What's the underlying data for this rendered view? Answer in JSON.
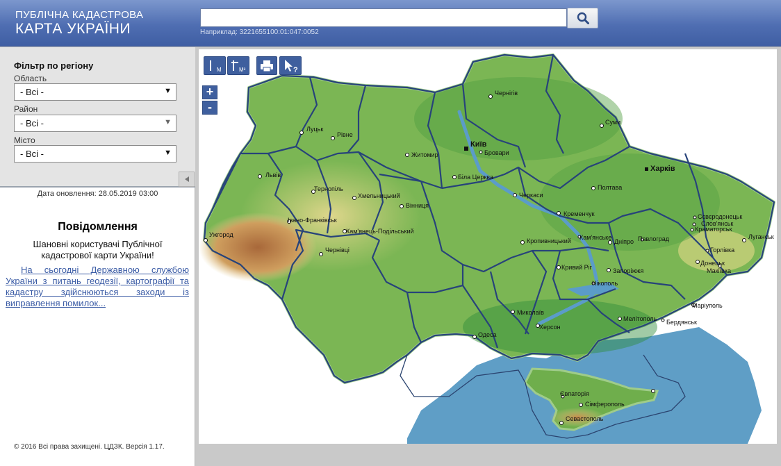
{
  "header": {
    "logo_line1": "ПУБЛІЧНА КАДАСТРОВА",
    "logo_line2": "КАРТА УКРАЇНИ",
    "search_value": "",
    "search_hint": "Наприклад: 3221655100:01:047:0052"
  },
  "filter": {
    "title": "Фільтр по регіону",
    "oblast_label": "Область",
    "oblast_value": "- Всі -",
    "rayon_label": "Район",
    "rayon_value": "- Всі -",
    "misto_label": "Місто",
    "misto_value": "- Всі -"
  },
  "sidebar": {
    "update_date": "Дата оновлення: 28.05.2019 03:00",
    "notice_title": "Повідомлення",
    "notice_subtitle": "Шановні користувачі Публічної кадастрової карти України!",
    "notice_link": "На сьогодні Державною службою України з питань геодезії, картографії та кадастру здійснюються заходи із виправлення помилок...",
    "copyright": "© 2016 Всі права захищені. ЦДЗК. Версія 1.17."
  },
  "toolbar": {
    "measure_length": "M",
    "measure_area": "M²",
    "print_icon": "printer-icon",
    "identify_icon": "cursor-question-icon",
    "identify_label": "?",
    "zoom_in": "+",
    "zoom_out": "-"
  },
  "map": {
    "cities": [
      {
        "name": "Чернігів"
      },
      {
        "name": "Суми"
      },
      {
        "name": "Луцьк"
      },
      {
        "name": "Рівне"
      },
      {
        "name": "Київ"
      },
      {
        "name": "Бровари"
      },
      {
        "name": "Житомир"
      },
      {
        "name": "Харків"
      },
      {
        "name": "Львів"
      },
      {
        "name": "Тернопіль"
      },
      {
        "name": "Хмельницький"
      },
      {
        "name": "Вінниця"
      },
      {
        "name": "Біла Церква"
      },
      {
        "name": "Черкаси"
      },
      {
        "name": "Полтава"
      },
      {
        "name": "Кременчук"
      },
      {
        "name": "Луганськ"
      },
      {
        "name": "Сєвєродонецьк"
      },
      {
        "name": "Слов'янськ"
      },
      {
        "name": "Краматорськ"
      },
      {
        "name": "Горлівка"
      },
      {
        "name": "Донецьк"
      },
      {
        "name": "Макіївка"
      },
      {
        "name": "Ужгород"
      },
      {
        "name": "Івано-Франківськ"
      },
      {
        "name": "Кам'янець-Подільський"
      },
      {
        "name": "Чернівці"
      },
      {
        "name": "Кропивницький"
      },
      {
        "name": "Кам'янське"
      },
      {
        "name": "Дніпро"
      },
      {
        "name": "Павлоград"
      },
      {
        "name": "Кривий Ріг"
      },
      {
        "name": "Запоріжжя"
      },
      {
        "name": "Нікополь"
      },
      {
        "name": "Маріуполь"
      },
      {
        "name": "Миколаїв"
      },
      {
        "name": "Херсон"
      },
      {
        "name": "Мелітополь"
      },
      {
        "name": "Бердянськ"
      },
      {
        "name": "Одеса"
      },
      {
        "name": "Євпаторія"
      },
      {
        "name": "Сімферополь"
      },
      {
        "name": "Севастополь"
      }
    ]
  },
  "colors": {
    "header_blue": "#4f6eb2",
    "button_blue": "#3f5f9e",
    "sea": "#5f9ec6",
    "lowland": "#6fb04a",
    "upland": "#e6d793",
    "mountain": "#b5763e",
    "border": "#27437a"
  }
}
